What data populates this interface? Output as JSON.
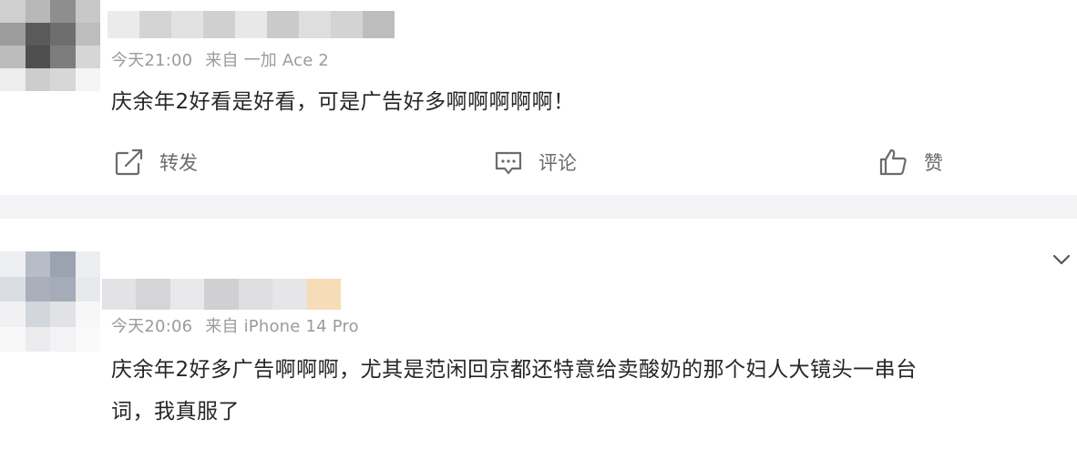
{
  "posts": [
    {
      "meta_time": "今天21:00",
      "meta_source": "来自 一加 Ace 2",
      "text": "庆余年2好看是好看，可是广告好多啊啊啊啊啊！",
      "actions": {
        "repost": "转发",
        "comment": "评论",
        "like": "赞"
      }
    },
    {
      "meta_time": "今天20:06",
      "meta_source": "来自 iPhone 14 Pro",
      "text_line1": "庆余年2好多广告啊啊啊，尤其是范闲回京都还特意给卖酸奶的那个妇人大镜头一串台",
      "text_line2": "词，我真服了"
    }
  ],
  "icons": {
    "repost": "repost-icon",
    "comment": "comment-icon",
    "like": "thumbs-up-icon",
    "expand": "chevron-down-icon"
  },
  "colors": {
    "background": "#f4f4f6",
    "card": "#ffffff",
    "meta_text": "#9a9aa0",
    "body_text": "#262626",
    "action_text": "#6b6b70"
  }
}
